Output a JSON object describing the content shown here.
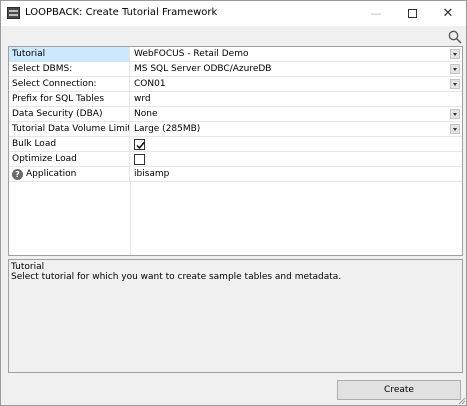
{
  "window": {
    "title": "LOOPBACK: Create Tutorial Framework",
    "controls": {
      "minimize": "—",
      "close": "✕"
    }
  },
  "properties": [
    {
      "label": "Tutorial",
      "value": "WebFOCUS - Retail Demo",
      "kind": "dropdown",
      "selected": true
    },
    {
      "label": "Select DBMS:",
      "value": "MS SQL Server ODBC/AzureDB",
      "kind": "dropdown"
    },
    {
      "label": "Select Connection:",
      "value": "CON01",
      "kind": "dropdown"
    },
    {
      "label": "Prefix for SQL Tables",
      "value": "wrd",
      "kind": "text"
    },
    {
      "label": "Data Security (DBA)",
      "value": "None",
      "kind": "dropdown"
    },
    {
      "label": "Tutorial Data Volume Limit",
      "value": "Large (285MB)",
      "kind": "dropdown"
    },
    {
      "label": "Bulk Load",
      "checked": true,
      "kind": "checkbox"
    },
    {
      "label": "Optimize Load",
      "checked": false,
      "kind": "checkbox"
    },
    {
      "label": "Application",
      "value": "ibisamp",
      "kind": "text",
      "help_icon": "?"
    }
  ],
  "description": {
    "title": "Tutorial",
    "text": "Select tutorial for which you want to create sample tables and metadata."
  },
  "buttons": {
    "create": "Create"
  },
  "colors": {
    "selected_row": "#cce8ff",
    "window_bg": "#f0f0f0",
    "grid_bg": "#ffffff",
    "button_bg": "#e1e1e1"
  },
  "icons": [
    "app-icon",
    "search-icon",
    "dropdown-arrow-icon",
    "checkmark-icon",
    "help-icon",
    "resize-grip-icon"
  ]
}
